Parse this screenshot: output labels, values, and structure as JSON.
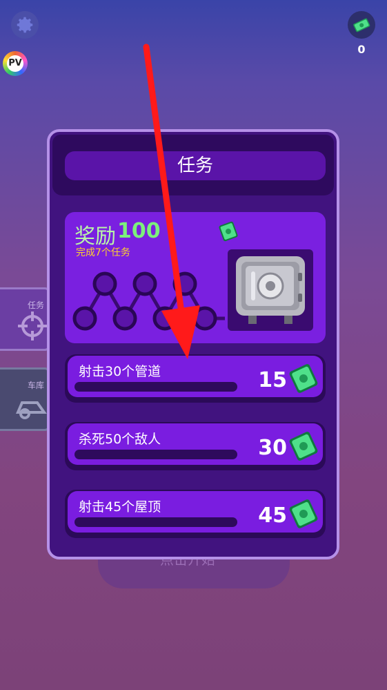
{
  "top_bar": {
    "settings_icon": "gear-icon",
    "currency_icon": "cash-icon",
    "currency_count": "0",
    "badge_text": "PV"
  },
  "background": {
    "side_tab_1": "任务",
    "side_tab_2": "车库",
    "start_text": "点击开始"
  },
  "modal": {
    "title": "任务",
    "reward": {
      "label": "奖励",
      "amount": "100",
      "subtitle": "完成7个任务"
    },
    "tasks": [
      {
        "name": "射击30个管道",
        "reward": "15",
        "progress": 0
      },
      {
        "name": "杀死50个敌人",
        "reward": "30",
        "progress": 0
      },
      {
        "name": "射击45个屋顶",
        "reward": "45",
        "progress": 0
      }
    ]
  },
  "colors": {
    "modal_bg": "#41137f",
    "accent_purple": "#7a1de0",
    "reward_green": "#7cf07c",
    "arrow_red": "#ff1a1a"
  }
}
